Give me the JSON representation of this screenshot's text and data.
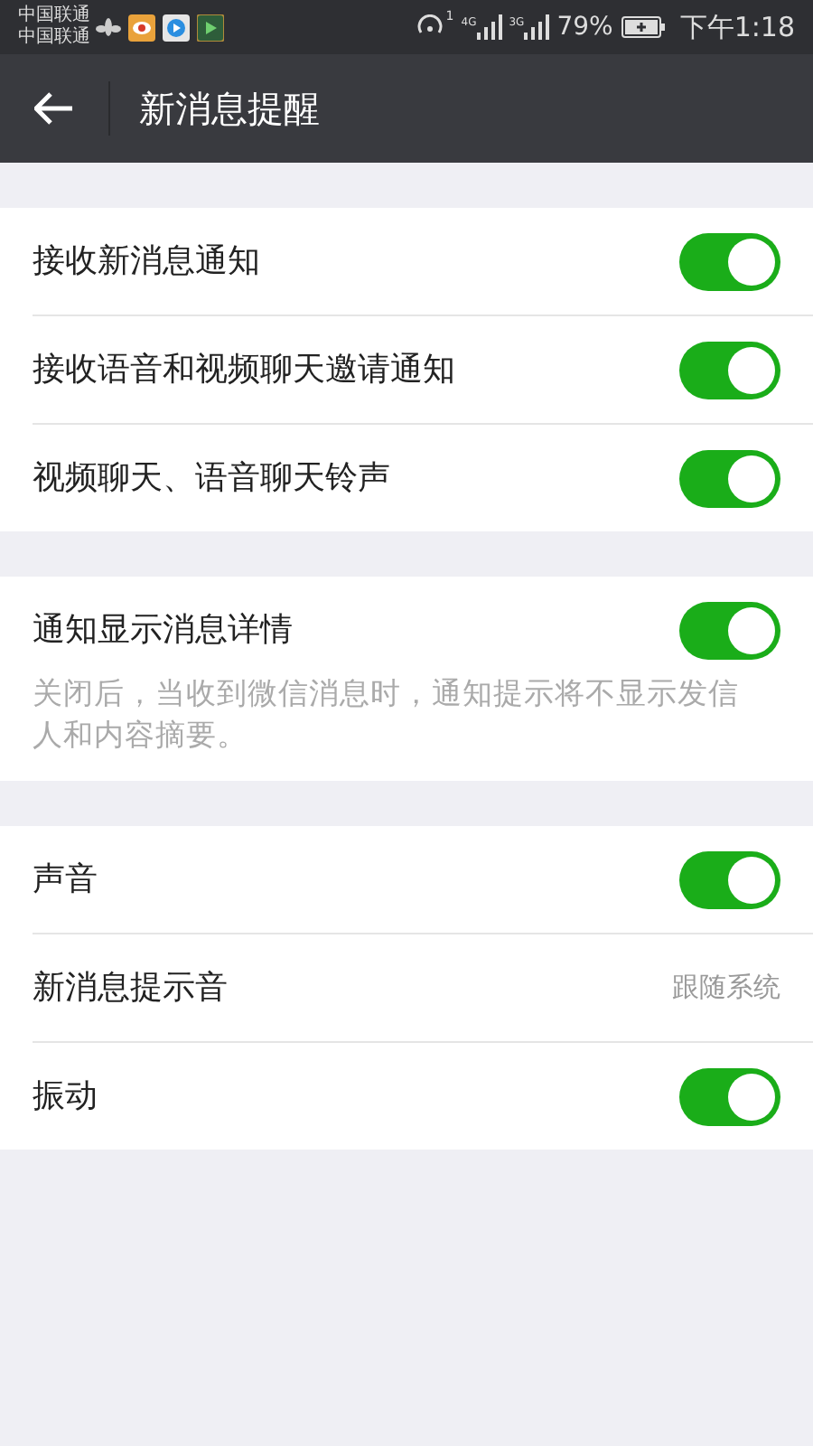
{
  "status_bar": {
    "carriers": [
      "中国联通",
      "中国联通"
    ],
    "hotspot_label": "1",
    "signal_labels": [
      "4G",
      "3G"
    ],
    "battery": "79%",
    "time": "下午1:18"
  },
  "header": {
    "title": "新消息提醒"
  },
  "sections": [
    {
      "items": [
        {
          "kind": "toggle",
          "label": "接收新消息通知",
          "on": true
        },
        {
          "kind": "toggle",
          "label": "接收语音和视频聊天邀请通知",
          "on": true
        },
        {
          "kind": "toggle",
          "label": "视频聊天、语音聊天铃声",
          "on": true
        }
      ]
    },
    {
      "items": [
        {
          "kind": "toggle",
          "label": "通知显示消息详情",
          "on": true,
          "description": "关闭后，当收到微信消息时，通知提示将不显示发信人和内容摘要。"
        }
      ]
    },
    {
      "items": [
        {
          "kind": "toggle",
          "label": "声音",
          "on": true
        },
        {
          "kind": "value",
          "label": "新消息提示音",
          "value": "跟随系统"
        },
        {
          "kind": "toggle",
          "label": "振动",
          "on": true
        }
      ]
    }
  ]
}
